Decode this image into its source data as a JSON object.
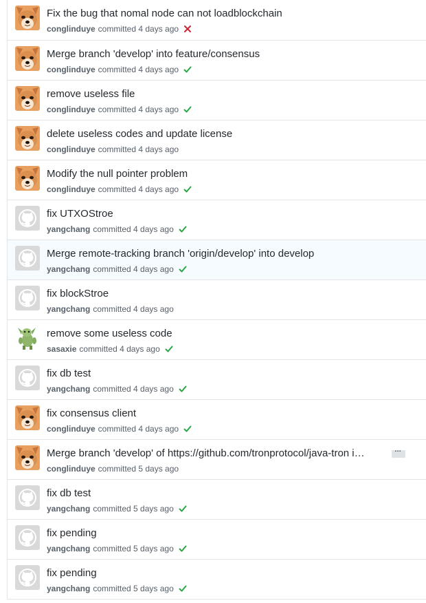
{
  "colors": {
    "success": "#28a745",
    "failure": "#cb2431",
    "title_text": "#24292e",
    "meta_text": "#586069",
    "row_highlight": "#f6fbff",
    "border": "#e1e4e8"
  },
  "commits": [
    {
      "title": "Fix the bug that nomal node can not loadblockchain",
      "author": "conglinduye",
      "meta": "committed 4 days ago",
      "avatar": "shiba-dog-avatar",
      "status": "failure"
    },
    {
      "title": "Merge branch 'develop' into feature/consensus",
      "author": "conglinduye",
      "meta": "committed 4 days ago",
      "avatar": "shiba-dog-avatar",
      "status": "success"
    },
    {
      "title": "remove useless file",
      "author": "conglinduye",
      "meta": "committed 4 days ago",
      "avatar": "shiba-dog-avatar",
      "status": "success"
    },
    {
      "title": "delete useless codes and update license",
      "author": "conglinduye",
      "meta": "committed 4 days ago",
      "avatar": "shiba-dog-avatar",
      "status": "none"
    },
    {
      "title": "Modify the null pointer problem",
      "author": "conglinduye",
      "meta": "committed 4 days ago",
      "avatar": "shiba-dog-avatar",
      "status": "success"
    },
    {
      "title": "fix UTXOStroe",
      "author": "yangchang",
      "meta": "committed 4 days ago",
      "avatar": "github-default-avatar",
      "status": "success"
    },
    {
      "title": "Merge remote-tracking branch 'origin/develop' into develop",
      "author": "yangchang",
      "meta": "committed 4 days ago",
      "avatar": "github-default-avatar",
      "status": "success",
      "highlighted": true
    },
    {
      "title": "fix blockStroe",
      "author": "yangchang",
      "meta": "committed 4 days ago",
      "avatar": "github-default-avatar",
      "status": "none"
    },
    {
      "title": "remove some useless code",
      "author": "sasaxie",
      "meta": "committed 4 days ago",
      "avatar": "green-character-avatar",
      "status": "success"
    },
    {
      "title": "fix db test",
      "author": "yangchang",
      "meta": "committed 4 days ago",
      "avatar": "github-default-avatar",
      "status": "success"
    },
    {
      "title": "fix consensus client",
      "author": "conglinduye",
      "meta": "committed 4 days ago",
      "avatar": "shiba-dog-avatar",
      "status": "success"
    },
    {
      "title": "Merge branch 'develop' of https://github.com/tronprotocol/java-tron i…",
      "author": "conglinduye",
      "meta": "committed 5 days ago",
      "avatar": "shiba-dog-avatar",
      "status": "none",
      "expander": "…"
    },
    {
      "title": "fix db test",
      "author": "yangchang",
      "meta": "committed 5 days ago",
      "avatar": "github-default-avatar",
      "status": "success"
    },
    {
      "title": "fix pending",
      "author": "yangchang",
      "meta": "committed 5 days ago",
      "avatar": "github-default-avatar",
      "status": "success"
    },
    {
      "title": "fix pending",
      "author": "yangchang",
      "meta": "committed 5 days ago",
      "avatar": "github-default-avatar",
      "status": "success"
    }
  ]
}
